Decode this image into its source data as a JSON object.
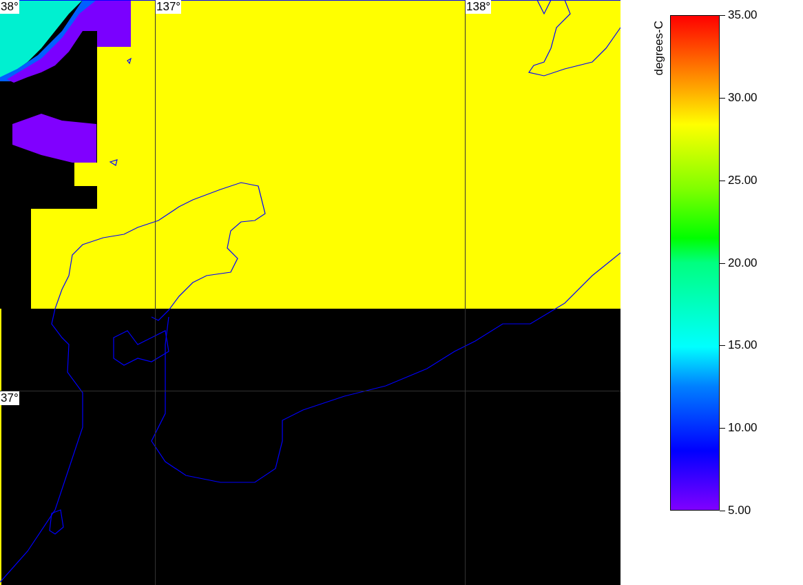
{
  "map": {
    "longitude_labels": [
      "137°",
      "138°"
    ],
    "latitude_labels": [
      "38°",
      "37°"
    ]
  },
  "colorbar": {
    "title": "degrees-C",
    "ticks": [
      "35.00",
      "30.00",
      "25.00",
      "20.00",
      "15.00",
      "10.00",
      "5.00"
    ]
  }
}
